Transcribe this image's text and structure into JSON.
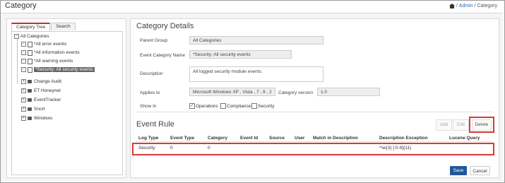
{
  "header": {
    "title": "Category",
    "breadcrumb_admin": "Admin",
    "breadcrumb_sep": "/",
    "breadcrumb_current": "Category"
  },
  "tabs": {
    "tree": "Category Tree",
    "search": "Search"
  },
  "tree": {
    "root": "All Categories",
    "children": [
      "*All error events",
      "*All information events",
      "*All warning events",
      "*Security: All security events"
    ],
    "folders": [
      "Change Audit",
      "ET Honeynet",
      "EventTracker",
      "Snort",
      "Windows"
    ]
  },
  "details": {
    "heading": "Category Details",
    "parent_group_label": "Parent Group",
    "parent_group_value": "All Categories",
    "event_category_name_label": "Event Category Name",
    "event_category_name_value": "*Security: All security events",
    "description_label": "Description",
    "description_value": "All logged security module events.",
    "applies_to_label": "Applies to",
    "applies_to_value": "Microsoft Windows XP , Vista , 7 , 8 , 2",
    "category_version_label": "Category version",
    "category_version_value": "1.0",
    "show_in_label": "Show In",
    "show_in_options": [
      {
        "label": "Operations",
        "checked": true
      },
      {
        "label": "Compliance",
        "checked": false
      },
      {
        "label": "Security",
        "checked": false
      }
    ]
  },
  "event_rule": {
    "heading": "Event Rule",
    "buttons": {
      "add": "Add",
      "edit": "Edit",
      "delete": "Delete"
    },
    "columns": [
      "Log Type",
      "Event Type",
      "Category",
      "Event Id",
      "Source",
      "User",
      "Match in Description",
      "Description Exception",
      "Lucene Query"
    ],
    "rows": [
      {
        "log_type": "Security",
        "event_type": "0",
        "category": "0",
        "event_id": "",
        "source": "",
        "user": "",
        "match": "",
        "exception": "^\\w{3} [:0-9]{11}",
        "lucene": ""
      }
    ]
  },
  "footer": {
    "save": "Save",
    "cancel": "Cancel"
  },
  "colors": {
    "accent_red": "#d83a36",
    "primary_blue": "#20589a"
  }
}
